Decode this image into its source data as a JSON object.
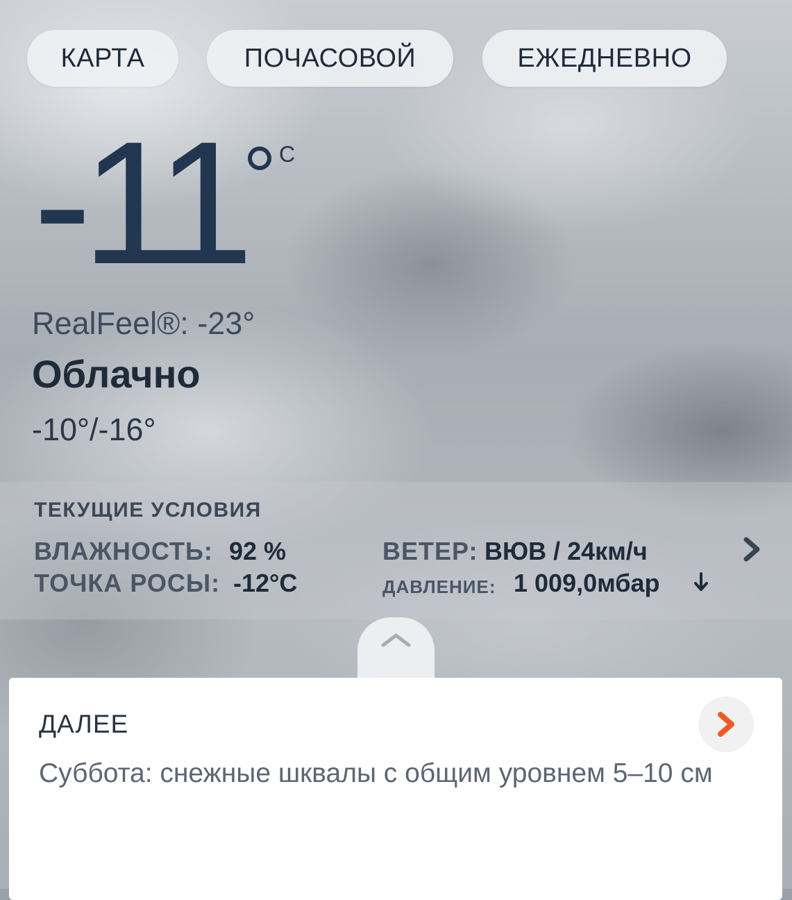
{
  "tabs": {
    "map": "КАРТА",
    "hourly": "ПОЧАСОВОЙ",
    "daily": "ЕЖЕДНЕВНО"
  },
  "current": {
    "temperature": "-11",
    "unit": "C",
    "realfeel": "RealFeel®: -23°",
    "condition": "Облачно",
    "high_low": "-10°/-16°"
  },
  "conditions": {
    "title": "ТЕКУЩИЕ УСЛОВИЯ",
    "humidity_label": "ВЛАЖНОСТЬ:",
    "humidity_value": "92 %",
    "dew_point_label": "ТОЧКА РОСЫ:",
    "dew_point_value": "-12°C",
    "wind_label": "ВЕТЕР:",
    "wind_value": "ВЮВ / 24км/ч",
    "pressure_label": "ДАВЛЕНИЕ:",
    "pressure_value": "1 009,0мбар"
  },
  "next": {
    "title": "ДАЛЕЕ",
    "text": "Суббота: снежные шквалы с общим уровнем 5–10 см"
  },
  "icons": {
    "pressure_trend": "arrow-down-icon",
    "conditions_more": "chevron-right-icon",
    "expand": "chevron-up-icon",
    "next_more": "chevron-right-icon"
  },
  "colors": {
    "accent": "#f05a22",
    "text_dark": "#233650"
  }
}
